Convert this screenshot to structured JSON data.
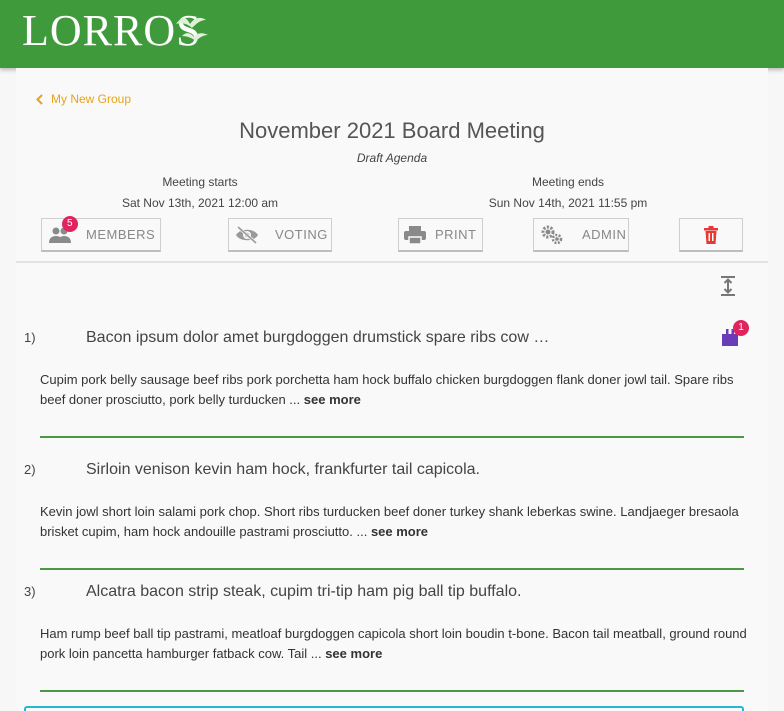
{
  "header": {
    "logo_text": "LORROS",
    "bg_color": "#3f9a3c"
  },
  "nav": {
    "back_label": "My New Group",
    "accent_color": "#e8a317"
  },
  "meeting": {
    "title": "November 2021 Board Meeting",
    "status": "Draft Agenda",
    "starts_label": "Meeting starts",
    "starts_value": "Sat Nov 13th, 2021 12:00 am",
    "ends_label": "Meeting ends",
    "ends_value": "Sun Nov 14th, 2021 11:55 pm"
  },
  "toolbar": {
    "members_label": "MEMBERS",
    "members_count": "5",
    "voting_label": "VOTING",
    "print_label": "PRINT",
    "admin_label": "ADMIN",
    "delete_icon": "trash-icon"
  },
  "agenda": {
    "items": [
      {
        "number": "1)",
        "title": "Bacon ipsum dolor amet burgdoggen drumstick spare ribs cow …",
        "body": "Cupim pork belly sausage beef ribs pork porchetta ham hock buffalo chicken burgdoggen flank doner jowl tail. Spare ribs beef doner prosciutto, pork belly turducken ... ",
        "see_more": "see more",
        "attachment_count": "1"
      },
      {
        "number": "2)",
        "title": "Sirloin venison kevin ham hock, frankfurter tail capicola.",
        "body": "Kevin jowl short loin salami pork chop. Short ribs turducken beef doner turkey shank leberkas swine. Landjaeger bresaola brisket cupim, ham hock andouille pastrami prosciutto. ... ",
        "see_more": "see more"
      },
      {
        "number": "3)",
        "title": "Alcatra bacon strip steak, cupim tri-tip ham pig ball tip buffalo.",
        "body": "Ham rump beef ball tip pastrami, meatloaf burgdoggen capicola short loin boudin t-bone. Bacon tail meatball, ground round pork loin pancetta hamburger fatback cow. Tail ... ",
        "see_more": "see more"
      }
    ]
  }
}
